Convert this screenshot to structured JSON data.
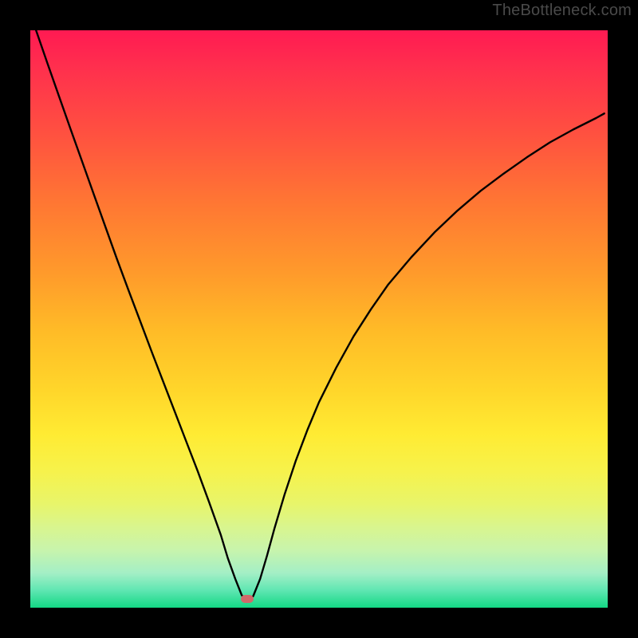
{
  "watermark": "TheBottleneck.com",
  "marker": {
    "x_frac": 0.375,
    "y_frac": 0.985
  },
  "chart_data": {
    "type": "line",
    "title": "",
    "xlabel": "",
    "ylabel": "",
    "xlim": [
      0,
      1
    ],
    "ylim": [
      0,
      1
    ],
    "series": [
      {
        "name": "bottleneck-curve",
        "x": [
          0.01,
          0.03,
          0.05,
          0.07,
          0.09,
          0.11,
          0.13,
          0.15,
          0.17,
          0.19,
          0.21,
          0.23,
          0.25,
          0.27,
          0.29,
          0.31,
          0.33,
          0.342,
          0.355,
          0.366,
          0.375,
          0.386,
          0.398,
          0.41,
          0.423,
          0.44,
          0.46,
          0.48,
          0.5,
          0.53,
          0.56,
          0.59,
          0.62,
          0.66,
          0.7,
          0.74,
          0.78,
          0.82,
          0.86,
          0.9,
          0.94,
          0.98,
          0.994
        ],
        "y": [
          1.0,
          0.942,
          0.885,
          0.828,
          0.772,
          0.716,
          0.66,
          0.604,
          0.55,
          0.497,
          0.444,
          0.392,
          0.34,
          0.288,
          0.236,
          0.182,
          0.126,
          0.086,
          0.05,
          0.022,
          0.01,
          0.02,
          0.05,
          0.09,
          0.138,
          0.195,
          0.255,
          0.308,
          0.356,
          0.416,
          0.47,
          0.517,
          0.56,
          0.607,
          0.65,
          0.688,
          0.722,
          0.752,
          0.78,
          0.806,
          0.828,
          0.848,
          0.856
        ]
      }
    ],
    "marker": {
      "x": 0.375,
      "y": 0.015
    }
  }
}
